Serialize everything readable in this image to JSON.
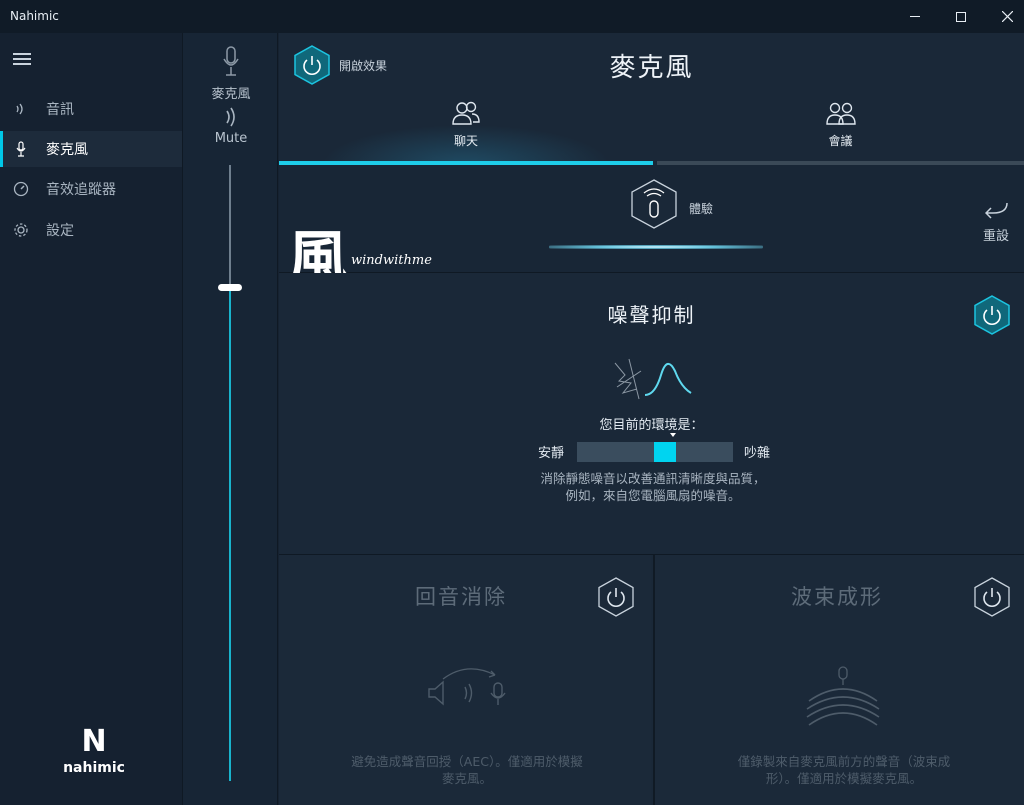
{
  "window": {
    "title": "Nahimic"
  },
  "sidebar": {
    "items": [
      {
        "label": "音訊",
        "icon": "speaker-icon"
      },
      {
        "label": "麥克風",
        "icon": "microphone-icon"
      },
      {
        "label": "音效追蹤器",
        "icon": "tracker-icon"
      },
      {
        "label": "設定",
        "icon": "gear-icon"
      }
    ],
    "active_index": 1,
    "logo_mark": "N",
    "logo_text": "nahimic"
  },
  "volume": {
    "device_label": "麥克風",
    "mute_label": "Mute",
    "level_fraction": 0.81
  },
  "header": {
    "effect_label": "開啟效果",
    "title": "麥克風"
  },
  "tabs": [
    {
      "label": "聊天",
      "icon": "users-icon",
      "active": true
    },
    {
      "label": "會議",
      "icon": "group-icon",
      "active": false
    }
  ],
  "experience": {
    "label": "體驗",
    "reset_label": "重設"
  },
  "watermark": {
    "brush": "風",
    "text": "windwithme"
  },
  "noise_suppression": {
    "title": "噪聲抑制",
    "env_label": "您目前的環境是：",
    "quiet_label": "安靜",
    "loud_label": "吵雜",
    "level_fraction": 0.56,
    "description": "消除靜態噪音以改善通訊清晰度與品質，例如，來自您電腦風扇的噪音。"
  },
  "echo_cancellation": {
    "title": "回音消除",
    "description": "避免造成聲音回授（AEC）。僅適用於模擬麥克風。"
  },
  "beamforming": {
    "title": "波束成形",
    "description": "僅錄製來自麥克風前方的聲音（波束成形）。僅適用於模擬麥克風。"
  },
  "colors": {
    "accent": "#1ecdea",
    "background": "#1a2838",
    "sidebar": "#152130"
  }
}
